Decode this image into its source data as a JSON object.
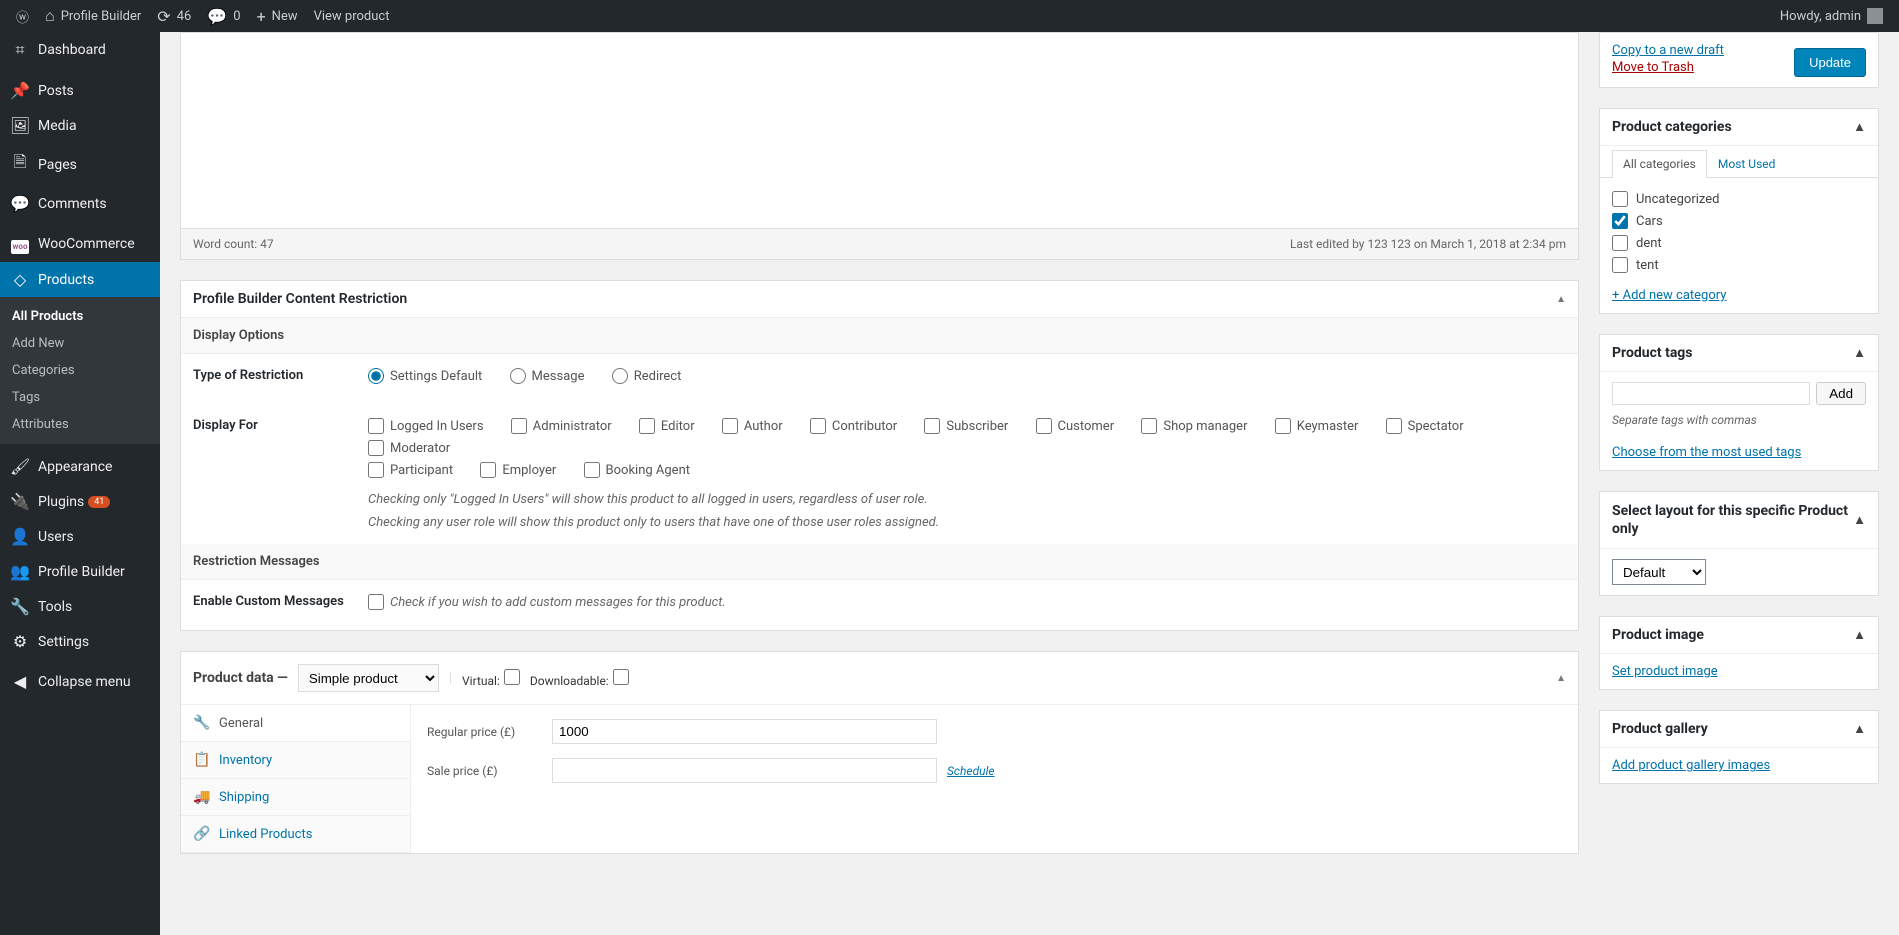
{
  "adminbar": {
    "site_title": "Profile Builder",
    "updates_count": "46",
    "comments_count": "0",
    "new_label": "New",
    "view_product_label": "View product",
    "howdy": "Howdy, admin"
  },
  "sidebar": {
    "dashboard": "Dashboard",
    "posts": "Posts",
    "media": "Media",
    "pages": "Pages",
    "comments": "Comments",
    "woocommerce": "WooCommerce",
    "products": "Products",
    "products_sub": {
      "all": "All Products",
      "add": "Add New",
      "categories": "Categories",
      "tags": "Tags",
      "attributes": "Attributes"
    },
    "appearance": "Appearance",
    "plugins": "Plugins",
    "plugins_badge": "41",
    "users": "Users",
    "profile_builder": "Profile Builder",
    "tools": "Tools",
    "settings": "Settings",
    "collapse": "Collapse menu"
  },
  "editor": {
    "word_count_label": "Word count: 47",
    "last_edited": "Last edited by 123 123 on March 1, 2018 at 2:34 pm"
  },
  "restriction": {
    "title": "Profile Builder Content Restriction",
    "display_options": "Display Options",
    "type_label": "Type of Restriction",
    "type_options": {
      "default": "Settings Default",
      "message": "Message",
      "redirect": "Redirect"
    },
    "display_for_label": "Display For",
    "roles": {
      "logged_in": "Logged In Users",
      "administrator": "Administrator",
      "editor": "Editor",
      "author": "Author",
      "contributor": "Contributor",
      "subscriber": "Subscriber",
      "customer": "Customer",
      "shop_manager": "Shop manager",
      "keymaster": "Keymaster",
      "spectator": "Spectator",
      "moderator": "Moderator",
      "participant": "Participant",
      "employer": "Employer",
      "booking_agent": "Booking Agent"
    },
    "help1": "Checking only \"Logged In Users\" will show this product to all logged in users, regardless of user role.",
    "help2": "Checking any user role will show this product only to users that have one of those user roles assigned.",
    "messages_heading": "Restriction Messages",
    "custom_label": "Enable Custom Messages",
    "custom_help": "Check if you wish to add custom messages for this product."
  },
  "product_data": {
    "title": "Product data",
    "type_selected": "Simple product",
    "virtual": "Virtual:",
    "downloadable": "Downloadable:",
    "tabs": {
      "general": "General",
      "inventory": "Inventory",
      "shipping": "Shipping",
      "linked": "Linked Products"
    },
    "regular_price_label": "Regular price (£)",
    "regular_price_value": "1000",
    "sale_price_label": "Sale price (£)",
    "sale_price_value": "",
    "schedule": "Schedule"
  },
  "publish": {
    "copy": "Copy to a new draft",
    "trash": "Move to Trash",
    "update": "Update"
  },
  "categories_box": {
    "title": "Product categories",
    "tab_all": "All categories",
    "tab_most": "Most Used",
    "items": {
      "uncategorized": "Uncategorized",
      "cars": "Cars",
      "dent": "dent",
      "tent": "tent"
    },
    "add_new": "+ Add new category"
  },
  "tags_box": {
    "title": "Product tags",
    "add": "Add",
    "help": "Separate tags with commas",
    "choose": "Choose from the most used tags"
  },
  "layout_box": {
    "title": "Select layout for this specific Product only",
    "selected": "Default"
  },
  "image_box": {
    "title": "Product image",
    "link": "Set product image"
  },
  "gallery_box": {
    "title": "Product gallery",
    "link": "Add product gallery images"
  }
}
